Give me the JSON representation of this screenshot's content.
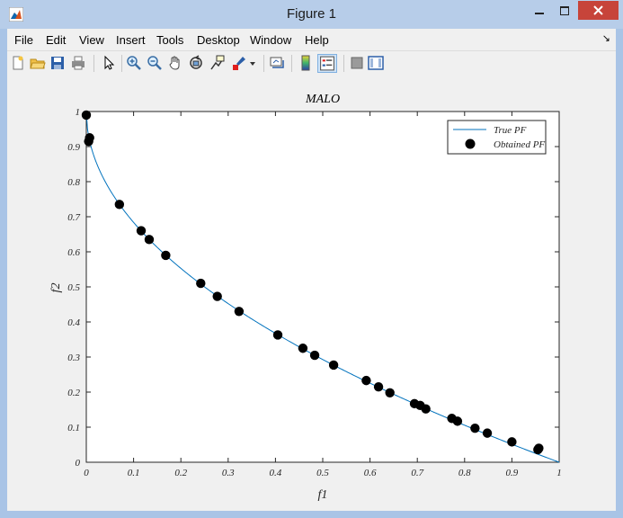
{
  "window": {
    "title": "Figure 1"
  },
  "menu": {
    "items": [
      "File",
      "Edit",
      "View",
      "Insert",
      "Tools",
      "Desktop",
      "Window",
      "Help"
    ],
    "arrow": "↘"
  },
  "toolbar": {
    "tools": [
      "new-figure-icon",
      "open-file-icon",
      "save-icon",
      "print-icon",
      "edit-plot-arrow-icon",
      "zoom-in-icon",
      "zoom-out-icon",
      "pan-hand-icon",
      "rotate-3d-icon",
      "data-cursor-icon",
      "brush-icon",
      "brush-dropdown-icon",
      "link-plot-icon",
      "colorbar-icon",
      "legend-icon",
      "hide-plot-tools-icon",
      "show-plot-tools-icon"
    ]
  },
  "chart_data": {
    "type": "scatter",
    "title": "MALO",
    "xlabel": "f1",
    "ylabel": "f2",
    "xlim": [
      0,
      1
    ],
    "ylim": [
      0,
      1
    ],
    "xticks": [
      "0",
      "0.1",
      "0.2",
      "0.3",
      "0.4",
      "0.5",
      "0.6",
      "0.7",
      "0.8",
      "0.9",
      "1"
    ],
    "yticks": [
      "0",
      "0.1",
      "0.2",
      "0.3",
      "0.4",
      "0.5",
      "0.6",
      "0.7",
      "0.8",
      "0.9",
      "1"
    ],
    "legend_position": "top-right",
    "series": [
      {
        "name": "True PF",
        "kind": "line",
        "color": "#0072bd",
        "function": "1 - sqrt(f1)"
      },
      {
        "name": "Obtained PF",
        "kind": "markers",
        "color": "#000000",
        "x": [
          0.0,
          0.005,
          0.007,
          0.07,
          0.116,
          0.133,
          0.168,
          0.242,
          0.277,
          0.323,
          0.405,
          0.458,
          0.483,
          0.523,
          0.592,
          0.618,
          0.642,
          0.694,
          0.706,
          0.718,
          0.773,
          0.785,
          0.822,
          0.848,
          0.9,
          0.955,
          0.957
        ],
        "y": [
          0.99,
          0.915,
          0.925,
          0.735,
          0.66,
          0.635,
          0.59,
          0.51,
          0.473,
          0.43,
          0.363,
          0.325,
          0.305,
          0.277,
          0.233,
          0.215,
          0.198,
          0.167,
          0.162,
          0.152,
          0.125,
          0.117,
          0.097,
          0.083,
          0.058,
          0.036,
          0.04
        ]
      }
    ]
  }
}
